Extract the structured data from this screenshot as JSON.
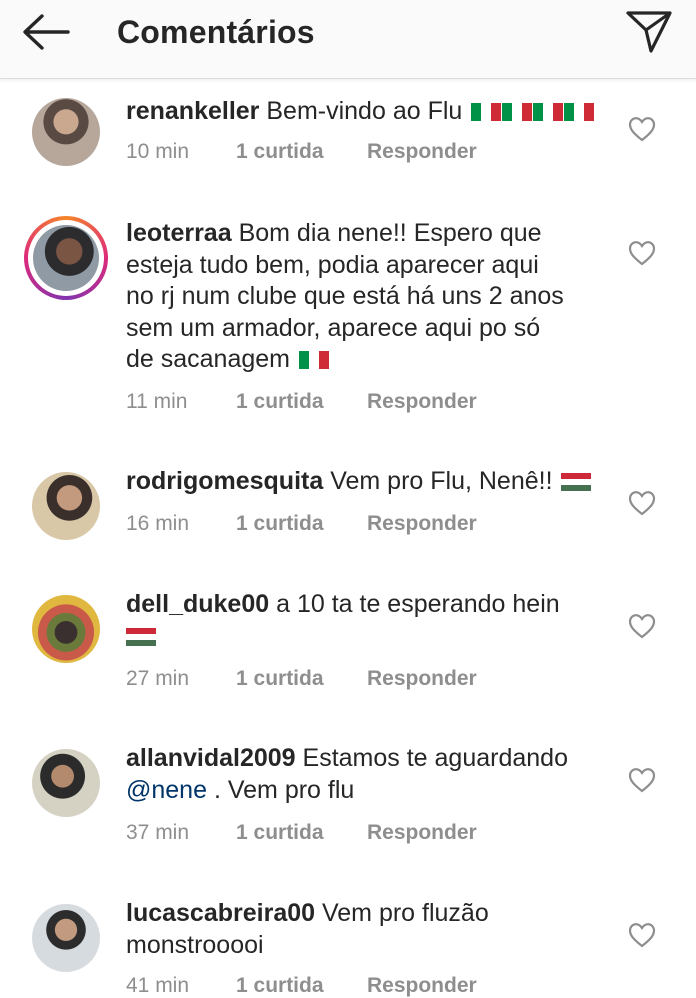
{
  "header": {
    "title": "Comentários",
    "back_icon": "arrow-left-icon",
    "send_icon": "paper-plane-icon"
  },
  "comments": [
    {
      "username": "renankeller",
      "text": "Bem-vindo ao Flu",
      "emoji": "italy-flag ×4",
      "time": "10 min",
      "likes": "1 curtida",
      "reply": "Responder"
    },
    {
      "username": "leoterraa",
      "text_lines": [
        "Bom dia nene!! Espero que",
        "esteja tudo bem, podia aparecer aqui",
        "no rj num clube que está há uns 2 anos",
        "sem um armador, aparece aqui po só",
        "de sacanagem"
      ],
      "emoji": "italy-flag",
      "time": "11 min",
      "likes": "1 curtida",
      "reply": "Responder",
      "has_story": true
    },
    {
      "username": "rodrigomesquita",
      "text": "Vem pro Flu, Nenê!!",
      "emoji": "hungary-flag",
      "time": "16 min",
      "likes": "1 curtida",
      "reply": "Responder"
    },
    {
      "username": "dell_duke00",
      "text": "a 10 ta te esperando hein",
      "emoji": "hungary-flag",
      "time": "27 min",
      "likes": "1 curtida",
      "reply": "Responder"
    },
    {
      "username": "allanvidal2009",
      "text": "Estamos te aguardando",
      "mention": "@nene",
      "text_after": ". Vem pro flu",
      "time": "37 min",
      "likes": "1 curtida",
      "reply": "Responder"
    },
    {
      "username": "lucascabreira00",
      "text": "Vem pro fluzão",
      "text_line2": "monstrooooi",
      "time": "41 min",
      "likes": "1 curtida",
      "reply": "Responder"
    }
  ],
  "colors": {
    "text": "#262626",
    "meta": "#8e8e8e",
    "mention": "#003569",
    "header_bg": "#fafafa"
  }
}
